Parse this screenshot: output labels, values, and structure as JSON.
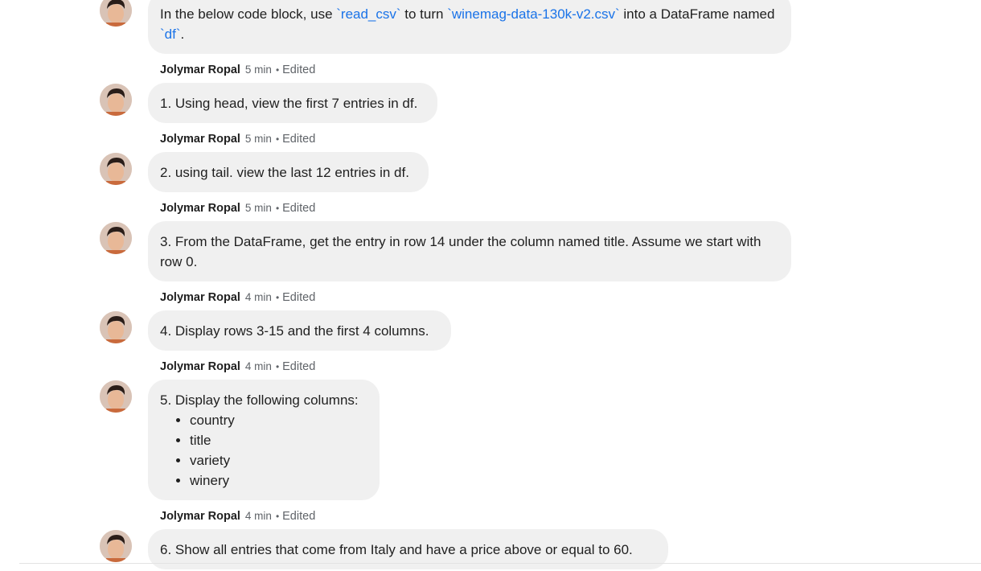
{
  "messages": [
    {
      "author": "",
      "time": "",
      "edited": "",
      "segments": [
        {
          "text": "In the below code block, use ",
          "code": false
        },
        {
          "text": "`read_csv`",
          "code": true
        },
        {
          "text": " to turn ",
          "code": false
        },
        {
          "text": "`winemag-data-130k-v2.csv`",
          "code": true
        },
        {
          "text": " into a DataFrame named ",
          "code": false
        },
        {
          "text": "`df`",
          "code": true
        },
        {
          "text": ".",
          "code": false
        }
      ]
    },
    {
      "author": "Jolymar Ropal",
      "time": "5 min",
      "edited": "Edited",
      "text": "1. Using head, view the first 7 entries in df."
    },
    {
      "author": "Jolymar Ropal",
      "time": "5 min",
      "edited": "Edited",
      "text": "2. using tail. view the last 12 entries in df."
    },
    {
      "author": "Jolymar Ropal",
      "time": "5 min",
      "edited": "Edited",
      "text": "3. From the DataFrame, get the entry in row 14 under the column named title. Assume we start with row 0."
    },
    {
      "author": "Jolymar Ropal",
      "time": "4 min",
      "edited": "Edited",
      "text": "4. Display rows 3-15 and the first 4 columns."
    },
    {
      "author": "Jolymar Ropal",
      "time": "4 min",
      "edited": "Edited",
      "text": "5. Display the following columns:",
      "list": [
        "country",
        "title",
        "variety",
        "winery"
      ]
    },
    {
      "author": "Jolymar Ropal",
      "time": "4 min",
      "edited": "Edited",
      "text": "6. Show all entries that come from Italy and have a price above or equal to 60."
    }
  ],
  "dot": "•",
  "icons": {
    "avatar": "avatar-icon"
  },
  "colors": {
    "bubble": "#f0f0f0",
    "code_link": "#1a73e8",
    "meta": "#5f6368"
  }
}
